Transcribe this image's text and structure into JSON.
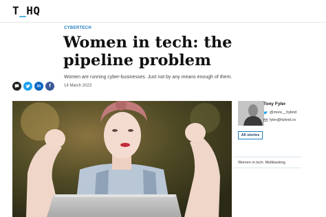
{
  "header": {
    "logo_main": "T",
    "logo_accent": "_",
    "logo_rest": "HQ"
  },
  "article": {
    "category": "CYBERTECH",
    "title": "Women in tech: the pipeline problem",
    "standfirst": "Women are running cyber-businesses. Just not by any means enough of them.",
    "date": "14 March 2023",
    "image_caption": "Women in tech. Multitasking."
  },
  "share": {
    "icons": [
      "comment-icon",
      "twitter-icon",
      "linkedin-icon",
      "facebook-icon"
    ],
    "comment_glyph": "💬",
    "twitter_glyph": "t",
    "linkedin_glyph": "in",
    "facebook_glyph": "f"
  },
  "author": {
    "name": "Tony Fyler",
    "twitter": "@more__hybrid",
    "email": "fyler@hybrid.co",
    "all_stories_label": "All stories"
  },
  "colors": {
    "accent_blue": "#1a7bbf",
    "logo_accent": "#1a9fd6",
    "twitter": "#1da1f2",
    "linkedin": "#0a66c2",
    "facebook": "#3b5998"
  }
}
